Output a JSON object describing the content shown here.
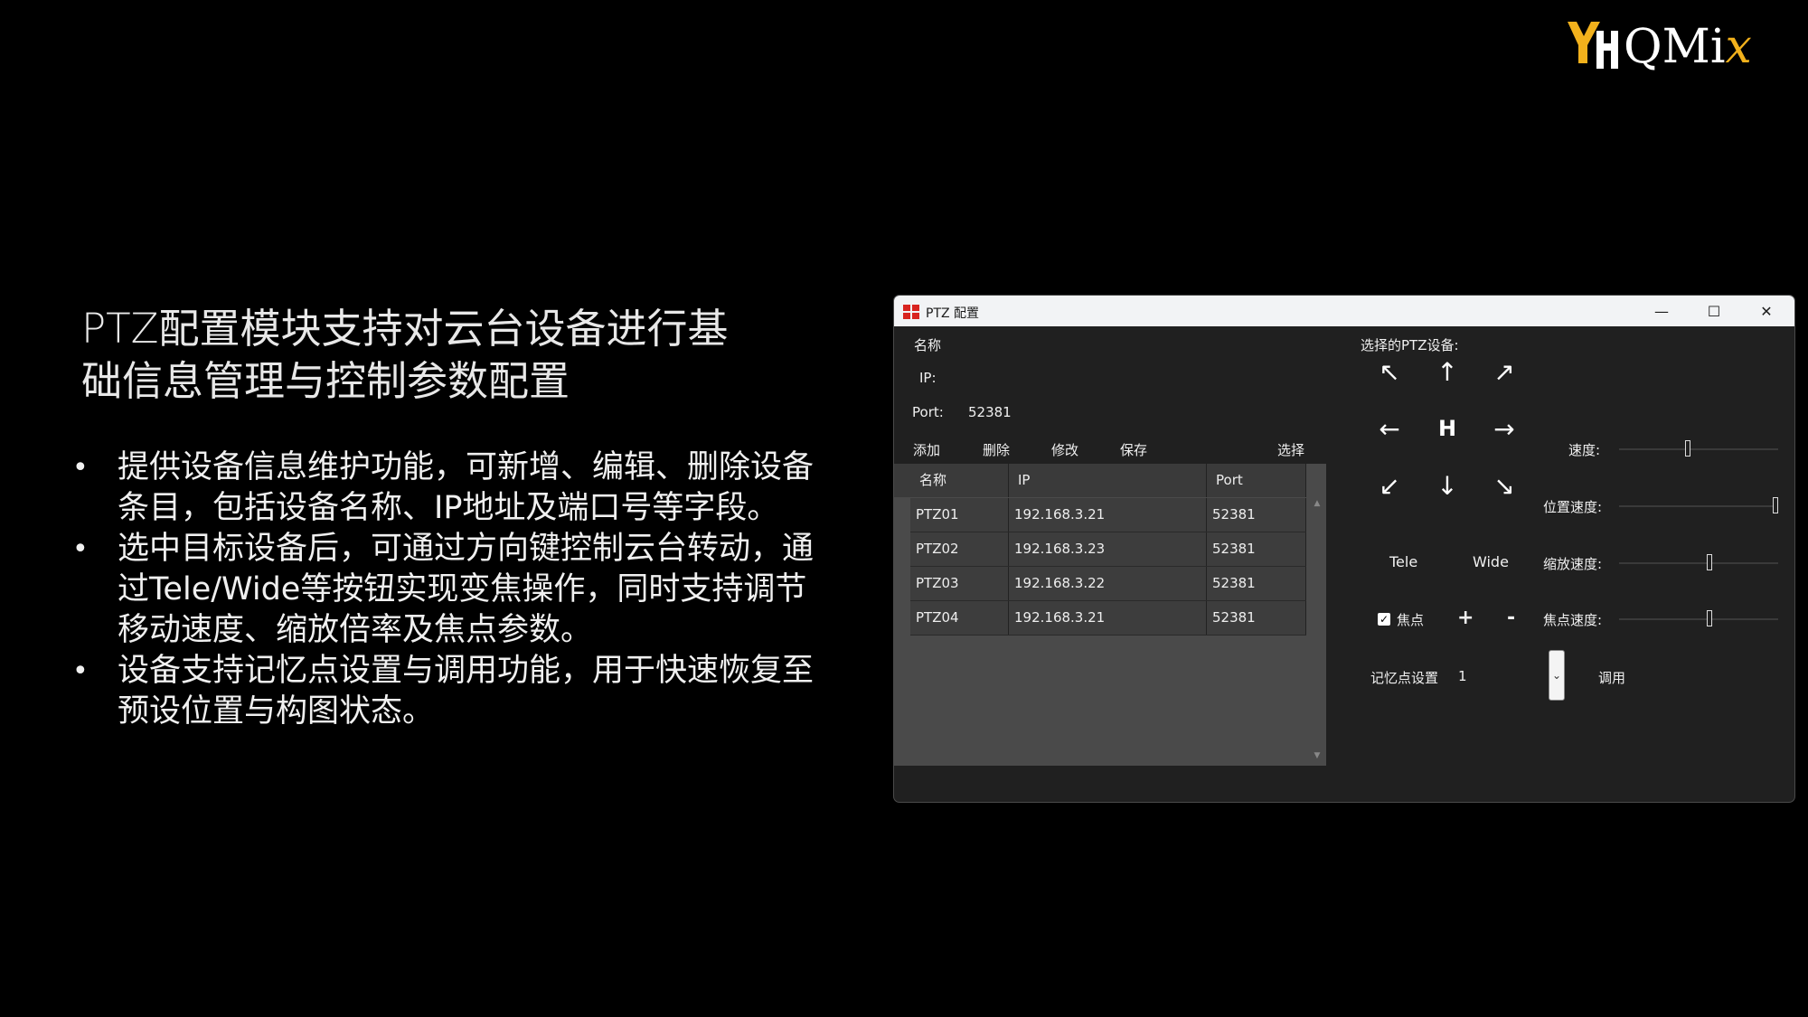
{
  "slide": {
    "headline": "PTZ配置模块支持对云台设备进行基础信息管理与控制参数配置",
    "bullets": [
      "提供设备信息维护功能，可新增、编辑、删除设备条目，包括设备名称、IP地址及端口号等字段。",
      "选中目标设备后，可通过方向键控制云台转动，通过Tele/Wide等按钮实现变焦操作，同时支持调节移动速度、缩放倍率及焦点参数。",
      "设备支持记忆点设置与调用功能，用于快速恢复至预设位置与构图状态。"
    ]
  },
  "logo": {
    "brand_text": "QMi",
    "brand_accent": "x",
    "accent_color": "#f2b11c",
    "icon": "yh-logo-icon"
  },
  "window": {
    "title": "PTZ 配置",
    "controls": {
      "minimize": "—",
      "maximize": "☐",
      "close": "✕"
    }
  },
  "form": {
    "name_label": "名称",
    "ip_label": "IP:",
    "port_label": "Port:",
    "port_value": "52381"
  },
  "actions": {
    "add": "添加",
    "delete": "删除",
    "edit": "修改",
    "save": "保存",
    "select": "选择"
  },
  "table": {
    "headers": [
      "名称",
      "IP",
      "Port"
    ],
    "rows": [
      [
        "PTZ01",
        "192.168.3.21",
        "52381"
      ],
      [
        "PTZ02",
        "192.168.3.23",
        "52381"
      ],
      [
        "PTZ03",
        "192.168.3.22",
        "52381"
      ],
      [
        "PTZ04",
        "192.168.3.21",
        "52381"
      ]
    ]
  },
  "control": {
    "selected_label": "选择的PTZ设备:",
    "arrows": {
      "up_left": "↖",
      "up": "↑",
      "up_right": "↗",
      "left": "←",
      "home": "H",
      "right": "→",
      "down_left": "↙",
      "down": "↓",
      "down_right": "↘"
    },
    "tele": "Tele",
    "wide": "Wide",
    "focus_checkbox": "焦点",
    "focus_checked": true,
    "focus_plus": "+",
    "focus_minus": "-",
    "speed_label": "速度:",
    "speed_level": 0.43,
    "position_speed_label": "位置速度:",
    "position_speed_level": 1.0,
    "zoom_speed_label": "缩放速度:",
    "zoom_speed_level": 0.57,
    "focus_speed_label": "焦点速度:",
    "focus_speed_level": 0.57,
    "memory_label": "记忆点设置",
    "memory_value": "1",
    "recall_button": "调用"
  }
}
